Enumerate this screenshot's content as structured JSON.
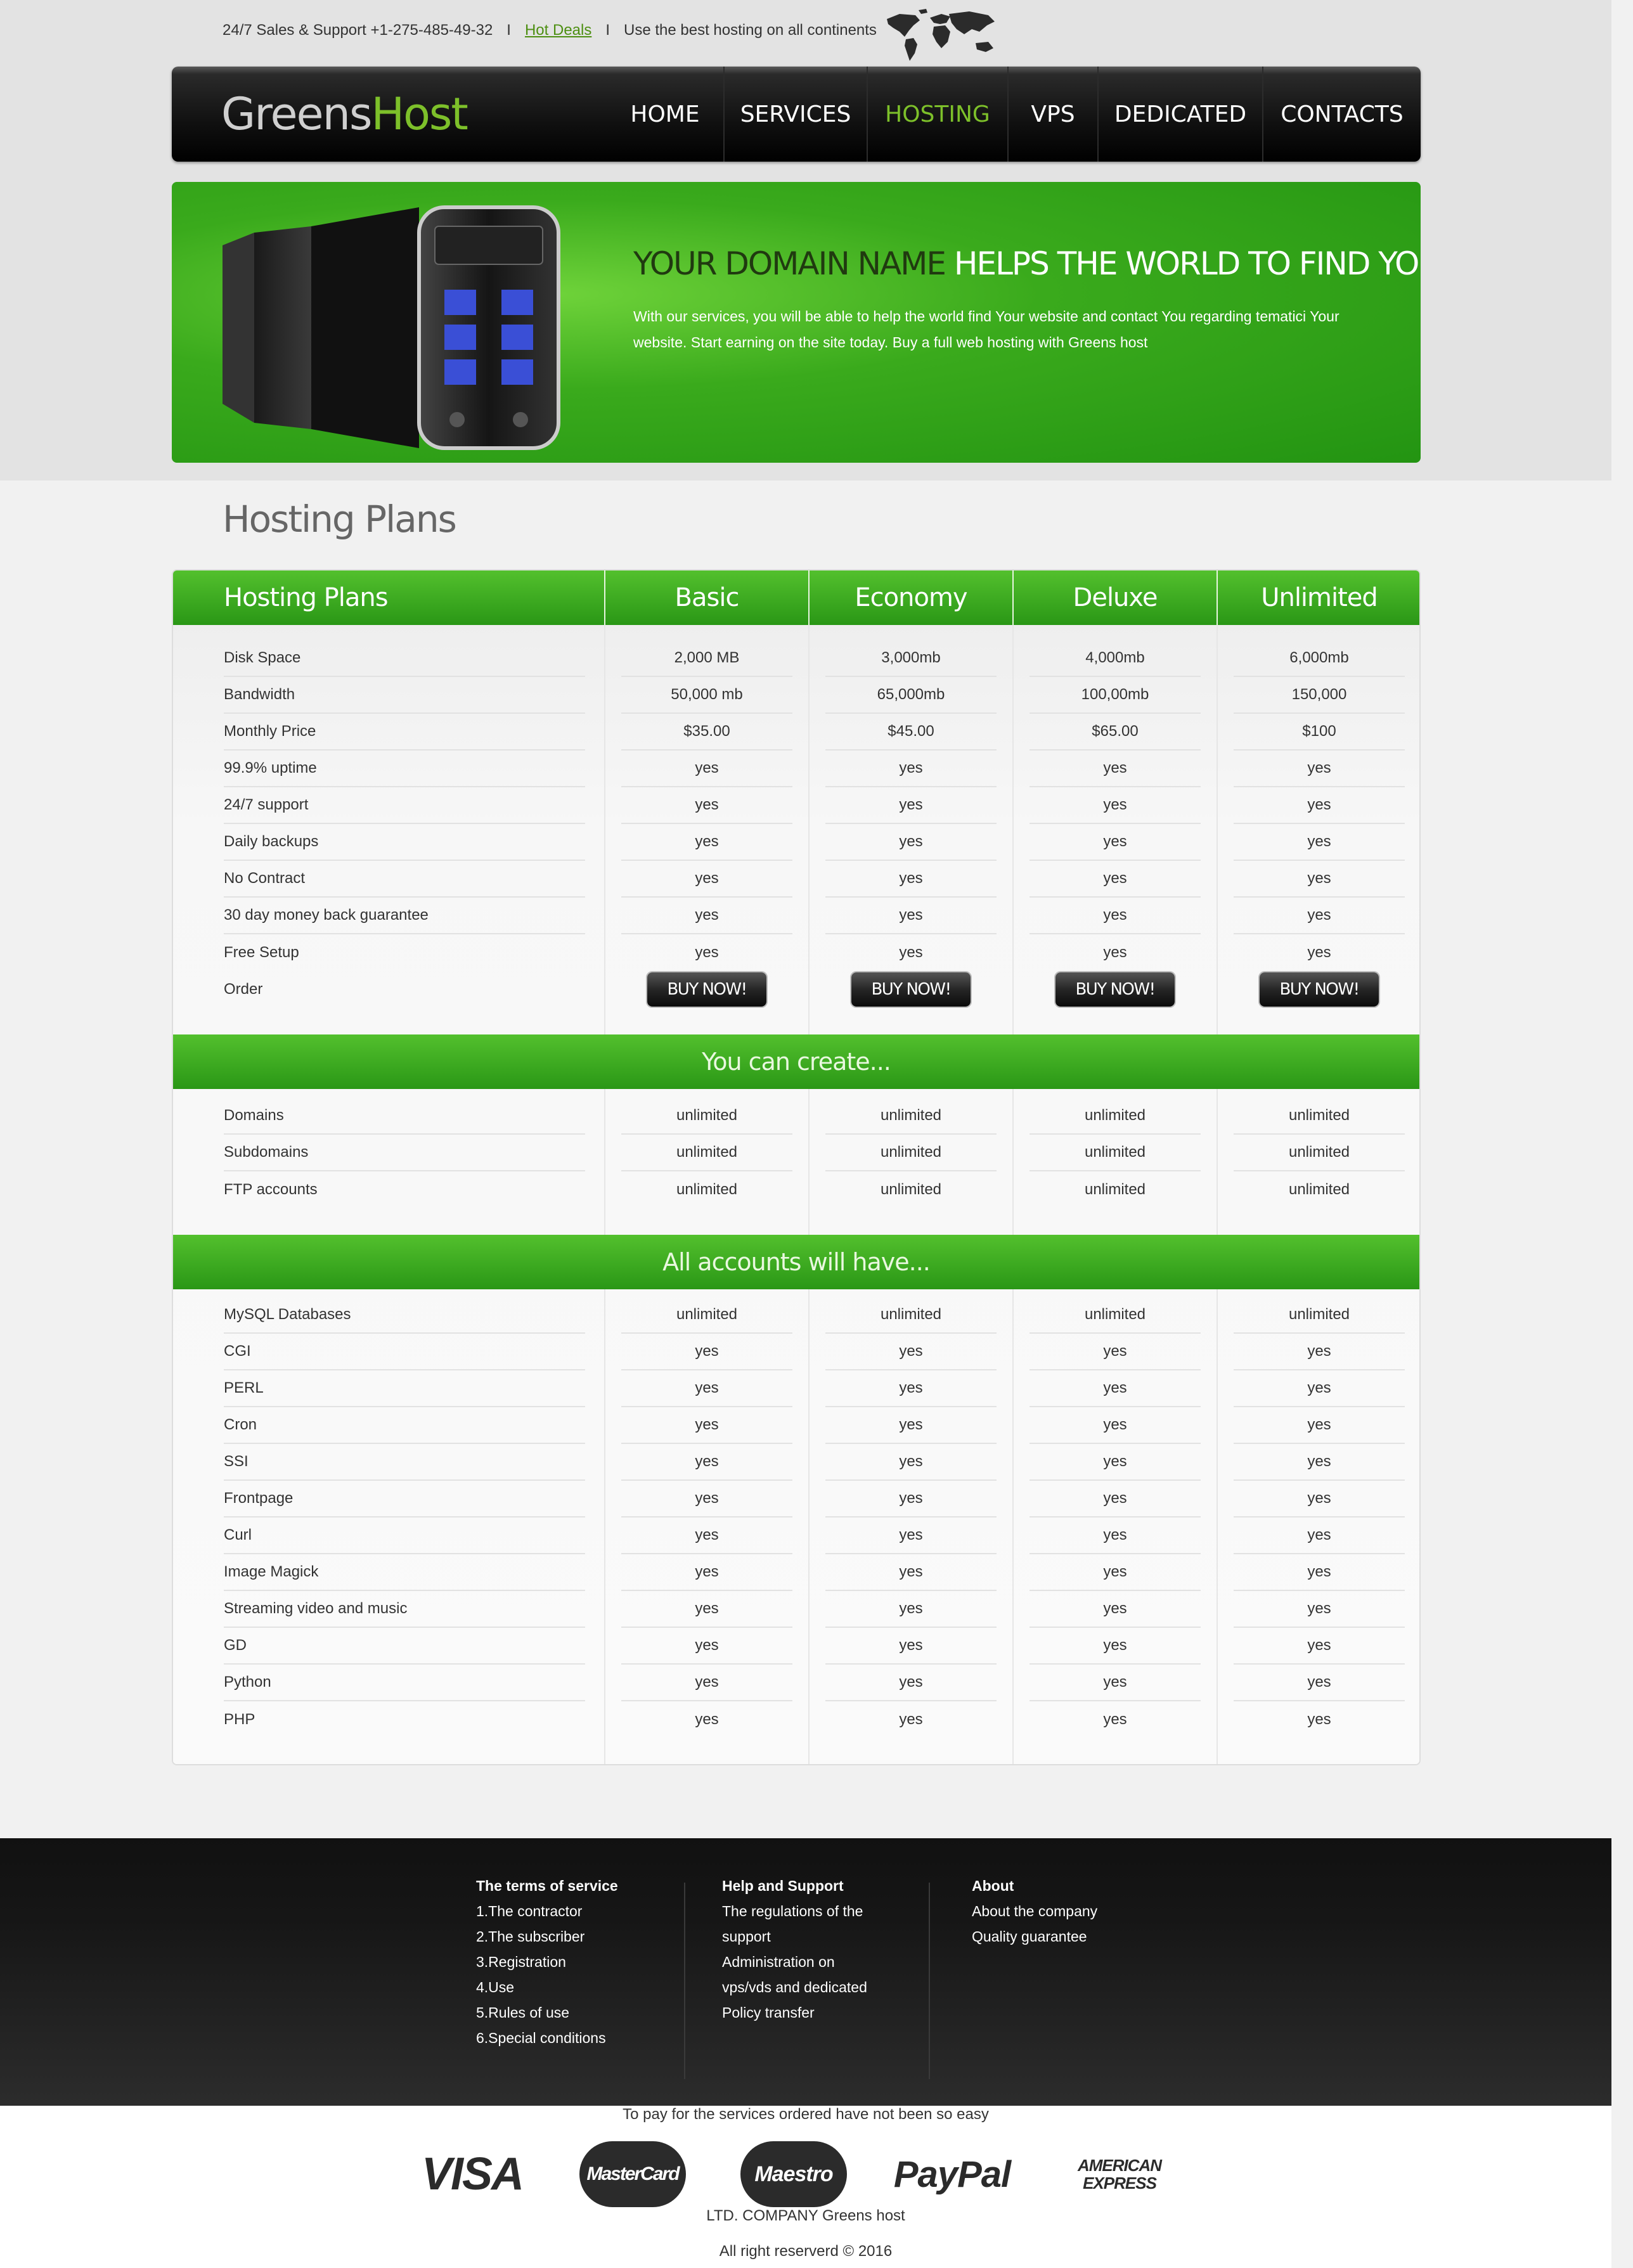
{
  "topbar": {
    "support": "24/7 Sales & Support +1-275-485-49-32",
    "separator": "I",
    "hot_deals": "Hot Deals",
    "tagline": "Use the best hosting on all continents",
    "map_icon": "world-map-icon"
  },
  "logo": {
    "part1": "Greens",
    "part2": "Host"
  },
  "nav": [
    "HOME",
    "SERVICES",
    "HOSTING",
    "VPS",
    "DEDICATED",
    "CONTACTS"
  ],
  "nav_active": "HOSTING",
  "banner": {
    "title_dark": "YOUR DOMAIN NAME",
    "title_light": "HELPS THE WORLD TO FIND YOU",
    "text": "With our services, you will be able to help the world find Your website and contact You regarding tematici Your website. Start earning on the site today. Buy a full web hosting with Greens host",
    "image_icon": "server-rack-icon"
  },
  "section_title": "Hosting Plans",
  "table": {
    "header_label": "Hosting Plans",
    "plans": [
      "Basic",
      "Economy",
      "Deluxe",
      "Unlimited"
    ],
    "main_rows": [
      {
        "label": "Disk Space",
        "values": [
          "2,000 MB",
          "3,000mb",
          "4,000mb",
          "6,000mb"
        ]
      },
      {
        "label": "Bandwidth",
        "values": [
          "50,000 mb",
          "65,000mb",
          "100,00mb",
          "150,000"
        ]
      },
      {
        "label": "Monthly Price",
        "values": [
          "$35.00",
          "$45.00",
          "$65.00",
          "$100"
        ]
      },
      {
        "label": "99.9% uptime",
        "values": [
          "yes",
          "yes",
          "yes",
          "yes"
        ]
      },
      {
        "label": "24/7 support",
        "values": [
          "yes",
          "yes",
          "yes",
          "yes"
        ]
      },
      {
        "label": "Daily backups",
        "values": [
          "yes",
          "yes",
          "yes",
          "yes"
        ]
      },
      {
        "label": "No Contract",
        "values": [
          "yes",
          "yes",
          "yes",
          "yes"
        ]
      },
      {
        "label": "30 day money back guarantee",
        "values": [
          "yes",
          "yes",
          "yes",
          "yes"
        ]
      },
      {
        "label": "Free Setup",
        "values": [
          "yes",
          "yes",
          "yes",
          "yes"
        ]
      }
    ],
    "order_label": "Order",
    "buy_label": "BUY NOW!",
    "create_title": "You can create...",
    "create_rows": [
      {
        "label": "Domains",
        "values": [
          "unlimited",
          "unlimited",
          "unlimited",
          "unlimited"
        ]
      },
      {
        "label": "Subdomains",
        "values": [
          "unlimited",
          "unlimited",
          "unlimited",
          "unlimited"
        ]
      },
      {
        "label": "FTP accounts",
        "values": [
          "unlimited",
          "unlimited",
          "unlimited",
          "unlimited"
        ]
      }
    ],
    "all_title": "All accounts will have...",
    "all_rows": [
      {
        "label": "MySQL Databases",
        "values": [
          "unlimited",
          "unlimited",
          "unlimited",
          "unlimited"
        ]
      },
      {
        "label": "CGI",
        "values": [
          "yes",
          "yes",
          "yes",
          "yes"
        ]
      },
      {
        "label": "PERL",
        "values": [
          "yes",
          "yes",
          "yes",
          "yes"
        ]
      },
      {
        "label": "Cron",
        "values": [
          "yes",
          "yes",
          "yes",
          "yes"
        ]
      },
      {
        "label": "SSI",
        "values": [
          "yes",
          "yes",
          "yes",
          "yes"
        ]
      },
      {
        "label": "Frontpage",
        "values": [
          "yes",
          "yes",
          "yes",
          "yes"
        ]
      },
      {
        "label": "Curl",
        "values": [
          "yes",
          "yes",
          "yes",
          "yes"
        ]
      },
      {
        "label": "Image Magick",
        "values": [
          "yes",
          "yes",
          "yes",
          "yes"
        ]
      },
      {
        "label": "Streaming video and music",
        "values": [
          "yes",
          "yes",
          "yes",
          "yes"
        ]
      },
      {
        "label": "GD",
        "values": [
          "yes",
          "yes",
          "yes",
          "yes"
        ]
      },
      {
        "label": "Python",
        "values": [
          "yes",
          "yes",
          "yes",
          "yes"
        ]
      },
      {
        "label": "PHP",
        "values": [
          "yes",
          "yes",
          "yes",
          "yes"
        ]
      }
    ]
  },
  "footer": {
    "columns": [
      {
        "title": "The terms of service",
        "links": [
          "1.The contractor",
          "2.The subscriber",
          "3.Registration",
          "4.Use",
          "5.Rules of use",
          "6.Special conditions"
        ]
      },
      {
        "title": "Help and Support",
        "links": [
          "The regulations of the",
          "support",
          "Administration on",
          "vps/vds and dedicated",
          "Policy transfer"
        ]
      },
      {
        "title": "About",
        "links": [
          "About the company",
          "Quality guarantee"
        ]
      }
    ]
  },
  "payment": {
    "text": "To pay for the services ordered have not been so easy",
    "logos": [
      "VISA",
      "MasterCard",
      "Maestro",
      "PayPal",
      "AMERICAN EXPRESS"
    ],
    "company": "LTD. COMPANY Greens host",
    "rights": "All right reserverd © 2016"
  },
  "colors": {
    "brand_green": "#7dc02a",
    "bar_green": "#2a9716",
    "nav_bg": "#101010"
  }
}
